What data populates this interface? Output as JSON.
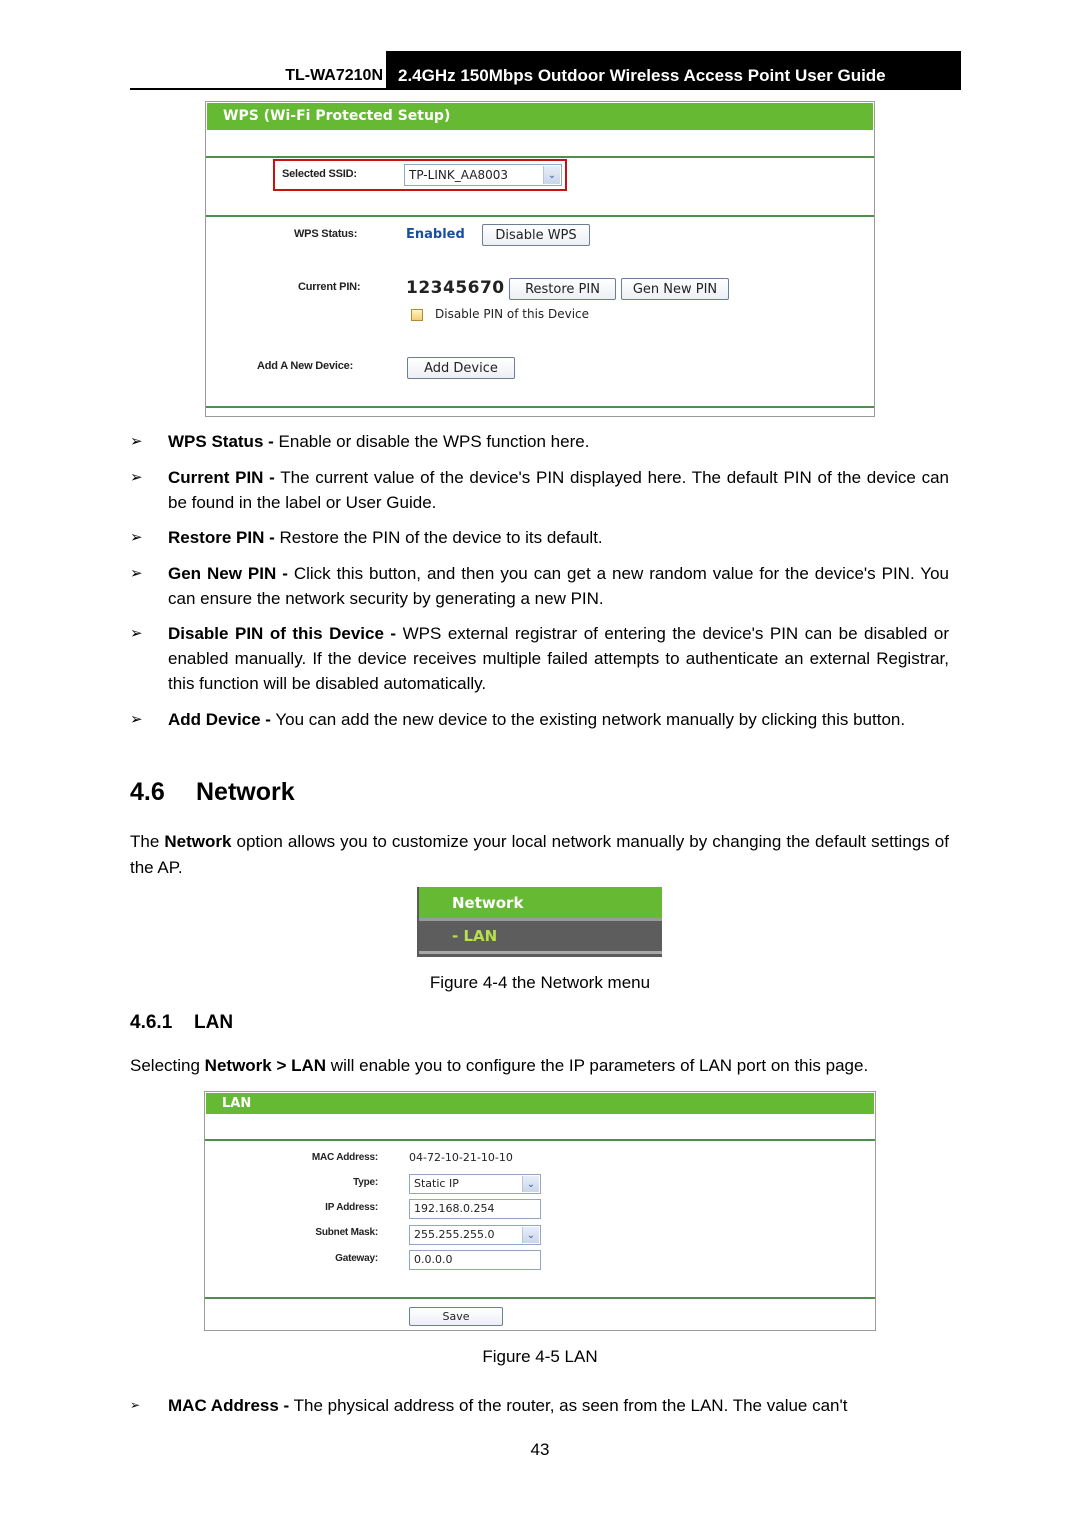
{
  "header": {
    "model": "TL-WA7210N",
    "guide_title": "2.4GHz 150Mbps Outdoor Wireless Access Point User Guide"
  },
  "wps_panel": {
    "title": "WPS (Wi-Fi Protected Setup)",
    "ssid_label": "Selected SSID:",
    "ssid_value": "TP-LINK_AA8003",
    "status_label": "WPS Status:",
    "status_value": "Enabled",
    "disable_wps_button": "Disable WPS",
    "pin_label": "Current PIN:",
    "pin_value": "12345670",
    "restore_pin_button": "Restore PIN",
    "gen_pin_button": "Gen New PIN",
    "disable_pin_checkbox_label": "Disable PIN of this Device",
    "disable_pin_checked": false,
    "add_device_label": "Add A New Device:",
    "add_device_button": "Add Device",
    "status_color": "#1a4fa0",
    "highlight_color": "#cc0000"
  },
  "wps_bullets": [
    {
      "term": "WPS Status -",
      "text": " Enable or disable the WPS function here."
    },
    {
      "term": "Current PIN -",
      "text": " The current value of the device's PIN displayed here. The default PIN of the device can be found in the label or User Guide."
    },
    {
      "term": "Restore PIN -",
      "text": " Restore the PIN of the device to its default."
    },
    {
      "term": "Gen New PIN -",
      "text": " Click this button, and then you can get a new random value for the device's PIN. You can ensure the network security by generating a new PIN."
    },
    {
      "term": "Disable PIN of this Device -",
      "text": " WPS external registrar of entering the device's PIN can be disabled or enabled manually. If the device receives multiple failed attempts to authenticate an external Registrar, this function will be disabled automatically."
    },
    {
      "term": "Add Device -",
      "text": " You can add the new device to the existing network manually by clicking this button."
    }
  ],
  "section_network": {
    "number": "4.6",
    "title": "Network",
    "intro_pre": "The ",
    "intro_bold": "Network",
    "intro_post": " option allows you to customize your local network manually by changing the default settings of the AP."
  },
  "network_menu": {
    "item": "Network",
    "subitem": "- LAN",
    "caption": "Figure 4-4 the Network menu"
  },
  "section_lan": {
    "number": "4.6.1",
    "title": "LAN",
    "intro_pre": "Selecting ",
    "intro_bold": "Network > LAN",
    "intro_post": " will enable you to configure the IP parameters of LAN port on this page."
  },
  "lan_panel": {
    "title": "LAN",
    "mac_label": "MAC Address:",
    "mac_value": "04-72-10-21-10-10",
    "type_label": "Type:",
    "type_value": "Static IP",
    "ip_label": "IP Address:",
    "ip_value": "192.168.0.254",
    "mask_label": "Subnet Mask:",
    "mask_value": "255.255.255.0",
    "gateway_label": "Gateway:",
    "gateway_value": "0.0.0.0",
    "save_button": "Save",
    "caption": "Figure 4-5 LAN"
  },
  "lan_bullets": [
    {
      "term": "MAC Address -",
      "text": " The physical address of the router, as seen from the LAN. The value can't"
    }
  ],
  "page_number": "43",
  "icons": {
    "bullet": "➢",
    "dropdown": "⌄"
  }
}
